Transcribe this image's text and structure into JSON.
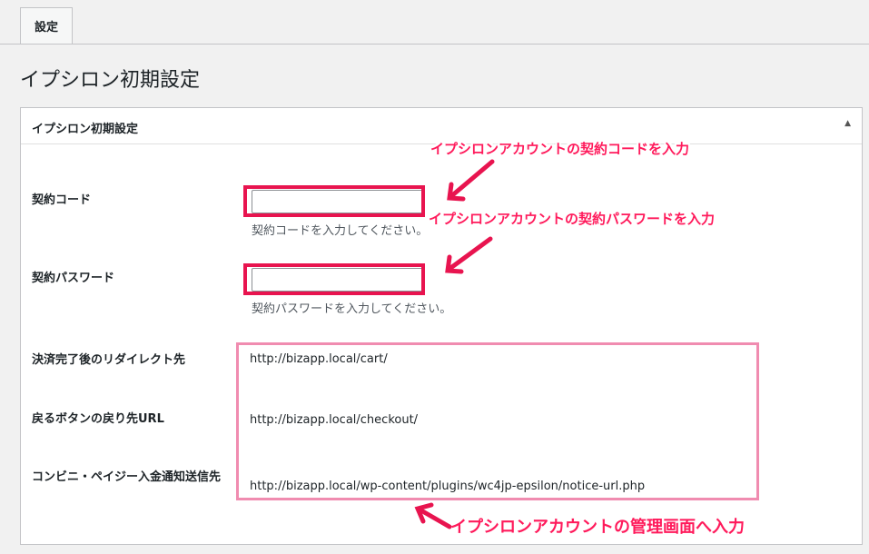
{
  "tabs": [
    {
      "label": "設定"
    }
  ],
  "page": {
    "title": "イプシロン初期設定"
  },
  "panel": {
    "title": "イプシロン初期設定",
    "toggle_icon": "triangle-up-icon",
    "fields": {
      "contract_code": {
        "label": "契約コード",
        "value": "",
        "description": "契約コードを入力してください。"
      },
      "contract_password": {
        "label": "契約パスワード",
        "value": "",
        "description": "契約パスワードを入力してください。"
      },
      "redirect_url": {
        "label": "決済完了後のリダイレクト先",
        "value": "http://bizapp.local/cart/"
      },
      "back_url": {
        "label": "戻るボタンの戻り先URL",
        "value": "http://bizapp.local/checkout/"
      },
      "notice_url": {
        "label": "コンビニ・ペイジー入金通知送信先",
        "value": "http://bizapp.local/wp-content/plugins/wc4jp-epsilon/notice-url.php"
      }
    }
  },
  "annotations": {
    "code_note": "イプシロンアカウントの契約コードを入力",
    "password_note": "イプシロンアカウントの契約パスワードを入力",
    "admin_note": "イプシロンアカウントの管理画面へ入力",
    "accent_color": "#e8144f",
    "box_color": "#f08cb0"
  }
}
